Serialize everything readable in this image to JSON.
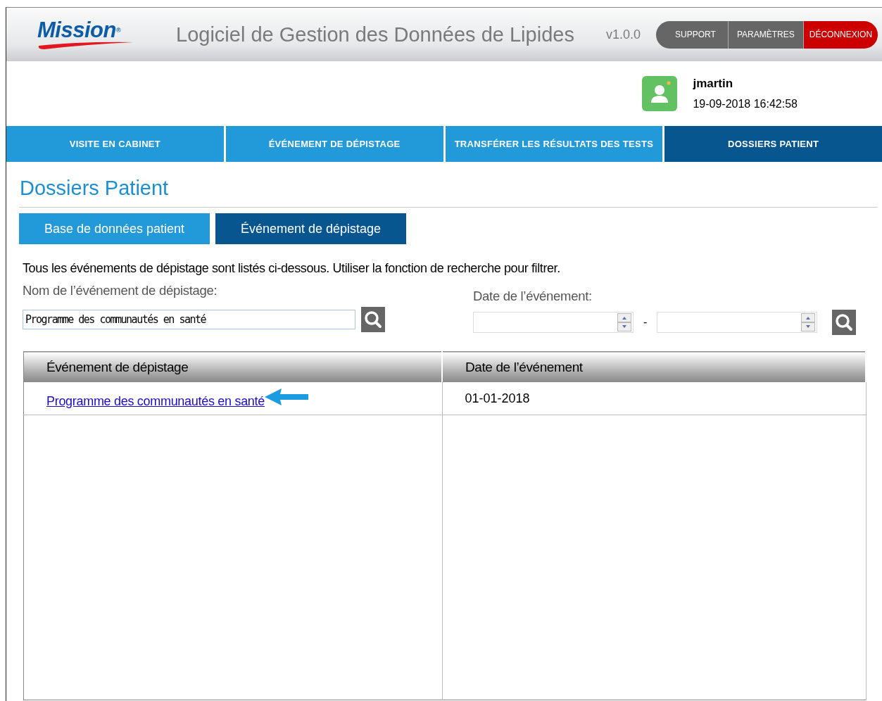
{
  "header": {
    "logo": {
      "text": "Mission",
      "mark": "®"
    },
    "title": "Logiciel de Gestion des Données de Lipides",
    "version": "v1.0.0",
    "buttons": [
      {
        "label": "SUPPORT",
        "kind": "normal"
      },
      {
        "label": "PARAMÈTRES",
        "kind": "normal"
      },
      {
        "label": "DÉCONNEXION",
        "kind": "danger"
      }
    ]
  },
  "user": {
    "name": "jmartin",
    "datetime": "19-09-2018 16:42:58"
  },
  "nav": [
    {
      "label": "VISITE EN CABINET",
      "selected": false
    },
    {
      "label": "ÉVÉNEMENT DE DÉPISTAGE",
      "selected": false
    },
    {
      "label": "TRANSFÉRER LES RÉSULTATS DES TESTS",
      "selected": false
    },
    {
      "label": "DOSSIERS PATIENT",
      "selected": true
    }
  ],
  "page_title": "Dossiers Patient",
  "sub_tabs": [
    {
      "label": "Base de données patient",
      "selected": false
    },
    {
      "label": "Événement de dépistage",
      "selected": true
    }
  ],
  "intro": "Tous les événements de dépistage sont listés ci-dessous. Utiliser la fonction de recherche pour filtrer.",
  "search": {
    "name_label": "Nom de l’événement de dépistage:",
    "name_value": "Programme des communautés en santé",
    "date_label": "Date de l’événement:",
    "date_separator": "-"
  },
  "table": {
    "columns": [
      "Événement de dépistage",
      "Date de l’événement"
    ],
    "rows": [
      {
        "event": "Programme des communautés en santé",
        "date": "01-01-2018",
        "pointed": true
      }
    ]
  }
}
